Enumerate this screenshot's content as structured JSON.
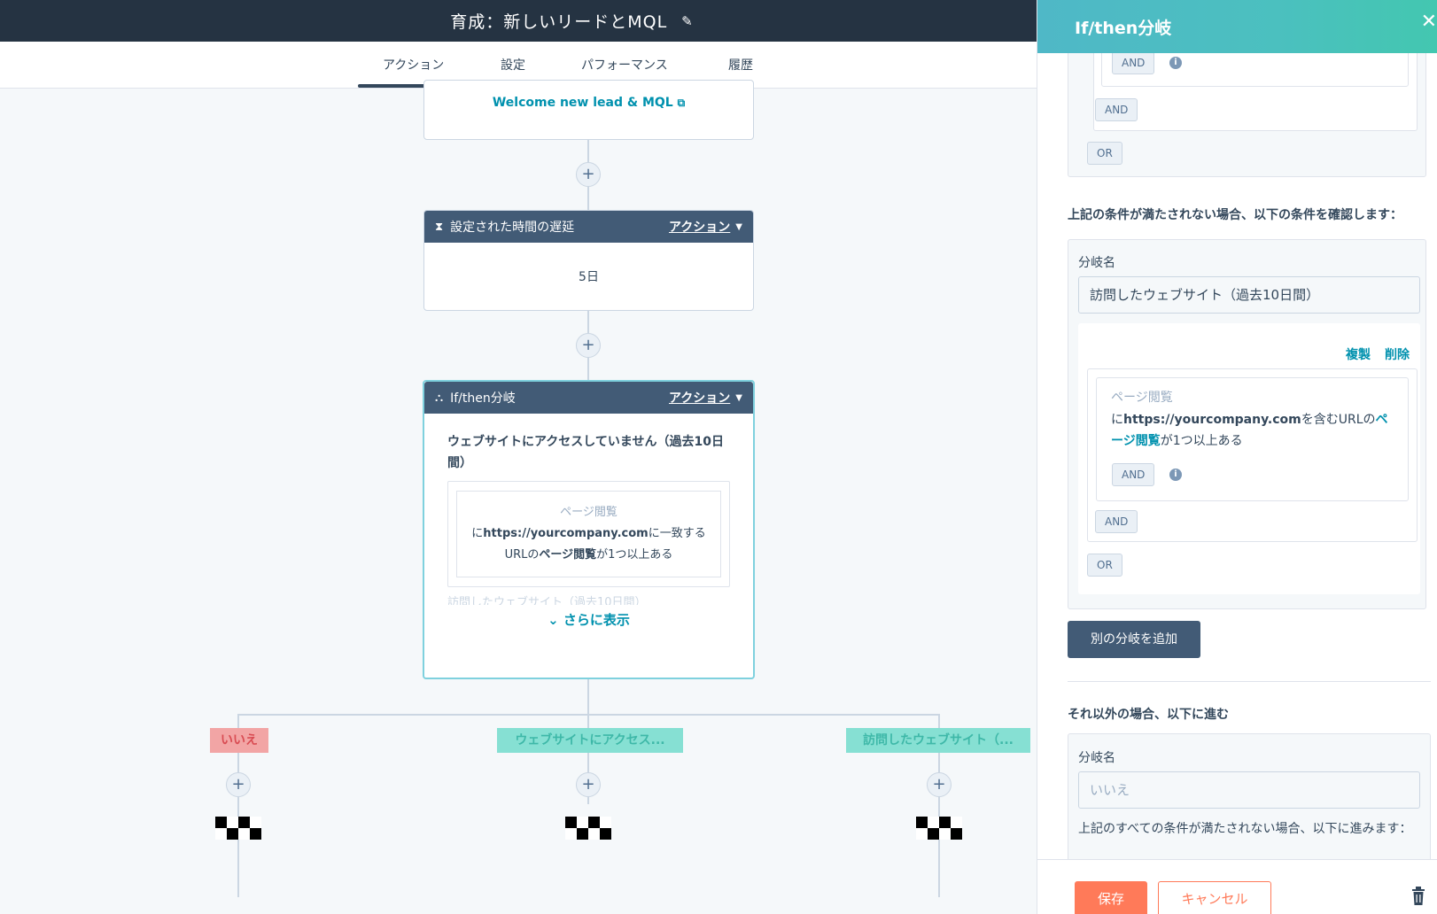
{
  "header": {
    "title": "育成：新しいリードとMQL",
    "edit_icon": "pencil-icon"
  },
  "tabs": [
    {
      "label": "アクション",
      "active": true
    },
    {
      "label": "設定",
      "active": false
    },
    {
      "label": "パフォーマンス",
      "active": false
    },
    {
      "label": "履歴",
      "active": false
    }
  ],
  "workflow": {
    "email_action": {
      "link_text": "Welcome new lead & MQL",
      "icon": "external-link-icon"
    },
    "add_step_icon": "+",
    "delay_action": {
      "label": "設定された時間の遅延",
      "icon": "hourglass-icon",
      "action_label": "アクション",
      "value": "5日"
    },
    "branch_action": {
      "label": "If/then分岐",
      "icon": "branch-icon",
      "action_label": "アクション",
      "branch_title": "ウェブサイトにアクセスしていません（過去10日間）",
      "filter_type": "ページ閲覧",
      "filter_prefix": "に",
      "filter_url": "https://yourcompany.com",
      "filter_mid": "に一致するURLの",
      "filter_bold": "ページ閲覧",
      "filter_suffix": "が1つ以上ある",
      "faded_next": "訪問したウェブサイト（過去10日間）",
      "show_more": "さらに表示"
    },
    "branches": [
      {
        "label": "いいえ",
        "color": "#f2a5a5"
      },
      {
        "label": "ウェブサイトにアクセス...",
        "color": "#86e0d3"
      },
      {
        "label": "訪問したウェブサイト（...",
        "color": "#86e0d3"
      }
    ]
  },
  "panel": {
    "title": "If/then分岐",
    "close_icon": "close-icon",
    "top_and_inner": "AND",
    "top_and_outer": "AND",
    "top_or": "OR",
    "else_if_heading": "上記の条件が満たされない場合、以下の条件を確認します：",
    "branch_name_label": "分岐名",
    "branch_name_value": "訪問したウェブサイト（過去10日間）",
    "duplicate": "複製",
    "delete": "削除",
    "filter_type": "ページ閲覧",
    "filter_prefix": "に",
    "filter_url": "https://yourcompany.com",
    "filter_mid": "を含むURLの",
    "filter_link": "ページ閲覧",
    "filter_suffix": "が1つ以上ある",
    "and_inner": "AND",
    "and_outer": "AND",
    "or_label": "OR",
    "add_branch_button": "別の分岐を追加",
    "otherwise_heading": "それ以外の場合、以下に進む",
    "otherwise_name_label": "分岐名",
    "otherwise_name_placeholder": "いいえ",
    "otherwise_note": "上記のすべての条件が満たされない場合、以下に進みます：",
    "save_button": "保存",
    "cancel_button": "キャンセル",
    "trash_icon": "trash-icon",
    "info_icon": "info-icon"
  }
}
